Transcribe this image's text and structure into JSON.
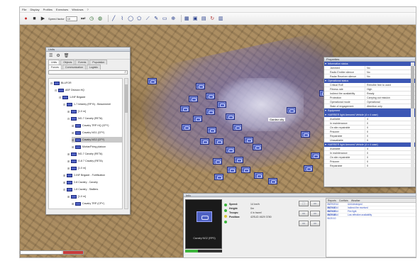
{
  "menu": [
    "File",
    "Display",
    "Profiles",
    "Exercises",
    "Windows",
    "?"
  ],
  "toolbar": {
    "speed_label": "Speed factor",
    "speed_value": "10",
    "icons": [
      "record-icon",
      "stop-icon",
      "play-icon",
      "pause-icon",
      "step-icon",
      "clock-icon",
      "globe-icon",
      "line-icon",
      "path-icon",
      "ellipse-icon",
      "polygon-icon",
      "measure-icon",
      "point-icon",
      "rectangle-icon",
      "zoom-icon",
      "grid-icon",
      "unit-icon",
      "unit-icon",
      "unit-icon",
      "refresh-icon",
      "map-icon"
    ]
  },
  "units_panel": {
    "title": "Units",
    "tabs": [
      "Units",
      "Objects",
      "Events",
      "Population"
    ],
    "subtabs": [
      "Forces",
      "Communication",
      "Logistic"
    ],
    "tree": [
      {
        "label": "BLUFOR",
        "level": 0,
        "open": true
      },
      {
        "label": "ABF Division HQ",
        "level": 1,
        "open": true
      },
      {
        "label": "1-INF Brigade",
        "level": 2,
        "open": true
      },
      {
        "label": "1-7 Infantry (RP B) - Bessemerel",
        "level": 3,
        "open": true
      },
      {
        "label": "[1.0 m]",
        "level": 4,
        "open": false
      },
      {
        "label": "NG-7 Cavalry (RETA)",
        "level": 4,
        "open": true
      },
      {
        "label": "Cavalry TRP HQ (CPY)",
        "level": 5,
        "open": false
      },
      {
        "label": "Cavalry NG1 (CPY)",
        "level": 5,
        "open": false
      },
      {
        "label": "Cavalry NG2 (CPY)",
        "level": 5,
        "open": false,
        "selected": true
      },
      {
        "label": "Mortar/Firing platoon",
        "level": 5,
        "open": false
      },
      {
        "label": "NG-7 Cavalry (RETA)",
        "level": 4,
        "open": false
      },
      {
        "label": "G-8 7 Cavalry (RETA)",
        "level": 4,
        "open": false
      },
      {
        "label": "[1.0 m]",
        "level": 4,
        "open": false
      },
      {
        "label": "2-INF Brigade - Fortification",
        "level": 3,
        "open": false
      },
      {
        "label": "2-8 Cavalry - Cavalry",
        "level": 3,
        "open": false
      },
      {
        "label": "1-8 Cavalry - Stalliers",
        "level": 3,
        "open": true
      },
      {
        "label": "[1.0 m]",
        "level": 4,
        "open": false
      },
      {
        "label": "Cavalry TRP (CPY)",
        "level": 5,
        "open": false
      }
    ]
  },
  "properties_panel": {
    "title": "Properties",
    "sections": [
      {
        "name": "Information status",
        "rows": [
          {
            "key": "Jammed",
            "value": "No"
          },
          {
            "key": "Radio Emitter silence",
            "value": "No"
          },
          {
            "key": "Radar Receiver silence",
            "value": "No"
          }
        ]
      },
      {
        "name": "Operational status",
        "rows": [
          {
            "key": "Critical RoE",
            "value": "Retrofire free to used"
          },
          {
            "key": "Fitness rate",
            "value": "High"
          },
          {
            "key": "Indirect fire availability",
            "value": "Ready"
          },
          {
            "key": "Protection",
            "value": "Carrying out mission"
          },
          {
            "key": "Operational mode",
            "value": "Operational"
          },
          {
            "key": "State of engagement",
            "value": "Attention only"
          }
        ]
      },
      {
        "name": "Equipment",
        "rows": []
      },
      {
        "name": "HARRIER light Armored Vehicle (4 x 4 case)",
        "rows": [
          {
            "key": "Available",
            "value": "4"
          },
          {
            "key": "In maintenance",
            "value": "0"
          },
          {
            "key": "On site repairable",
            "value": "0"
          },
          {
            "key": "Prisoner",
            "value": "0"
          },
          {
            "key": "Repairable",
            "value": "0"
          },
          {
            "key": "Unavailable",
            "value": "0"
          }
        ]
      },
      {
        "name": "HARRIER light Armored Vehicle (4 x 4 case)",
        "rows": [
          {
            "key": "Available",
            "value": "4"
          },
          {
            "key": "In maintenance",
            "value": "0"
          },
          {
            "key": "On site repairable",
            "value": "0"
          },
          {
            "key": "Prisoner",
            "value": "0"
          },
          {
            "key": "Repairable",
            "value": "0"
          }
        ]
      }
    ]
  },
  "map": {
    "label": "Gardez city"
  },
  "info_panel": {
    "title": "Info",
    "unit_name": "Cavalry NG2 (RPS)",
    "health_fraction": 0.35,
    "stats": [
      {
        "key": "Speed:",
        "value": "14 km/h"
      },
      {
        "key": "Height:",
        "value": "0m"
      },
      {
        "key": "Troops:",
        "value": "4 in travel"
      },
      {
        "key": "Position:",
        "value": "42SUD 4629 3780"
      }
    ],
    "dot_colors": [
      "#3cb43c",
      "#3cb43c",
      "#d8c63a",
      "#3cb43c"
    ],
    "buttons": [
      "⛶",
      "▭",
      "▭",
      "▭",
      "▭",
      "▭"
    ],
    "message_tabs": [
      "Reports",
      "Conflicts",
      "Weather"
    ],
    "messages": [
      {
        "time": "08/29/2014 06:21:40",
        "text": "Unit destroyed"
      },
      {
        "time": "08/29/2014 06:21:03",
        "text": "Indirect fire received"
      },
      {
        "time": "08/29/2014 06:20:48",
        "text": "Fire fight"
      },
      {
        "time": "08/29/2014 06:20:10",
        "text": "Low effective availability"
      }
    ]
  },
  "timeline": {
    "progress_fraction": 0.66
  }
}
